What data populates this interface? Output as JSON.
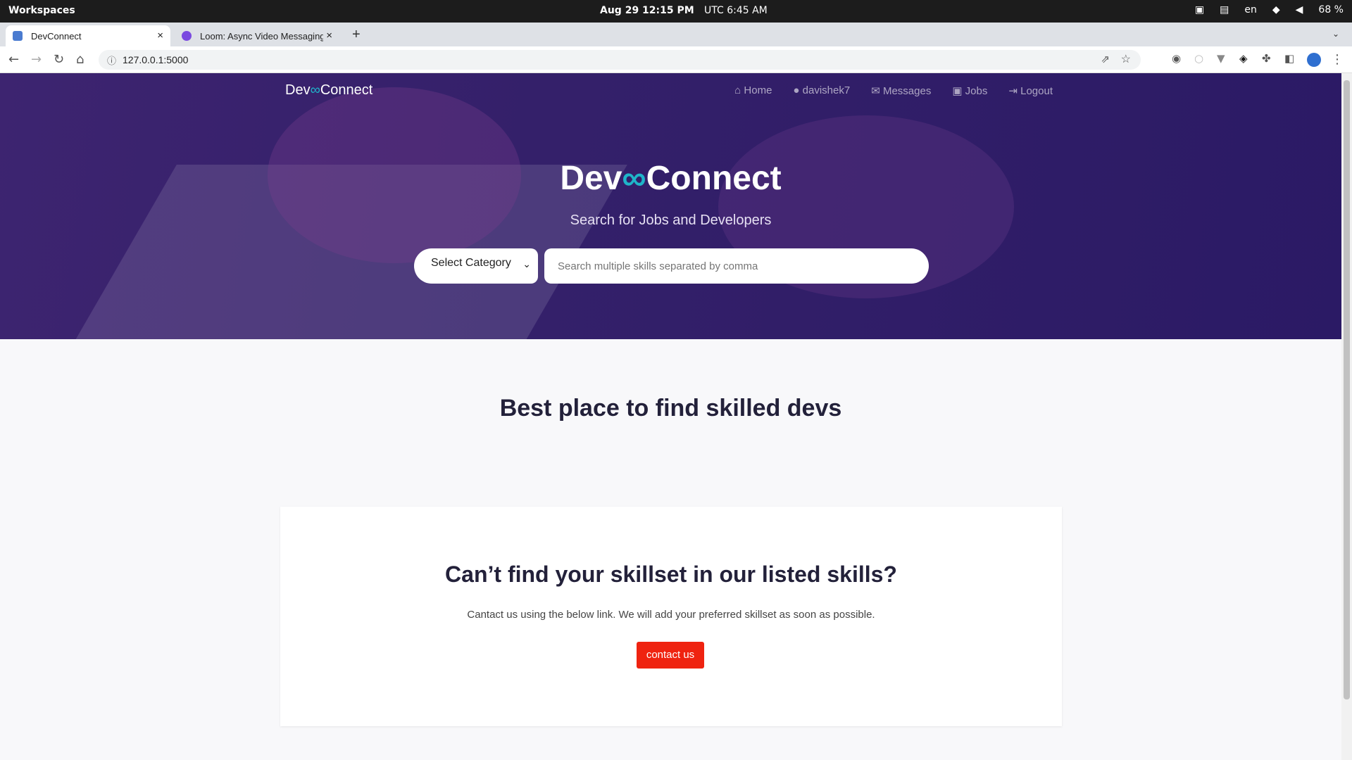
{
  "os": {
    "workspaces": "Workspaces",
    "datetime": "Aug 29  12:15 PM",
    "utc": "UTC 6:45 AM",
    "lang": "en",
    "battery": "68 %"
  },
  "tabs": [
    {
      "title": "DevConnect"
    },
    {
      "title": "Loom: Async Video Messaging"
    }
  ],
  "address": {
    "url": "127.0.0.1:5000"
  },
  "nav": {
    "brand_left": "Dev",
    "brand_right": "Connect",
    "items": [
      "Home",
      "davishek7",
      "Messages",
      "Jobs",
      "Logout"
    ]
  },
  "hero": {
    "title_left": "Dev",
    "title_right": "Connect",
    "subtitle": "Search for Jobs and Developers",
    "select_label": "Select Category",
    "search_placeholder": "Search multiple skills separated by comma"
  },
  "tagline": "Best place to find skilled devs",
  "card": {
    "title": "Can’t find your skillset in our listed skills?",
    "text": "Cantact us using the below link. We will add your preferred skillset as soon as possible.",
    "button": "contact us"
  },
  "colors": {
    "hero": "#34206a",
    "accent": "#1fb5c9",
    "button": "#ef2310"
  }
}
